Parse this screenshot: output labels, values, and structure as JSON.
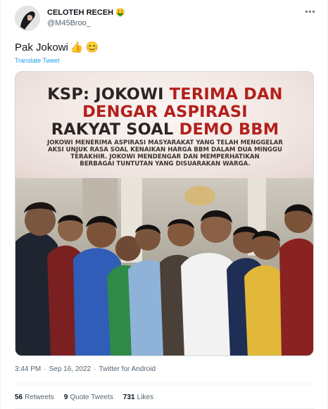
{
  "user": {
    "display_name": "CELOTEH RECEH",
    "name_emoji": "🤑",
    "handle": "@M45Broo_"
  },
  "tweet": {
    "text": "Pak Jokowi",
    "text_emojis": [
      "👍",
      "😊"
    ],
    "translate_label": "Translate Tweet"
  },
  "media": {
    "headline_line1_dark": "KSP: JOKOWI ",
    "headline_line1_red": "TERIMA DAN",
    "headline_line2_red": "DENGAR ASPIRASI",
    "headline_line3_dark": "RAKYAT SOAL ",
    "headline_line3_red": "DEMO BBM",
    "caption_lines": [
      "JOKOWI MENERIMA ASPIRASI MASYARAKAT YANG TELAH MENGGELAR",
      "AKSI UNJUK RASA SOAL KENAIKAN HARGA BBM DALAM DUA MINGGU",
      "TERAKHIR. JOKOWI MENDENGAR DAN MEMPERHATIKAN",
      "BERBAGAI TUNTUTAN YANG DISUARAKAN WARGA."
    ],
    "colors": {
      "headline_dark": "#2b2422",
      "headline_red": "#b3201c"
    }
  },
  "meta": {
    "time": "3:44 PM",
    "separator": "·",
    "date": "Sep 16, 2022",
    "source": "Twitter for Android"
  },
  "stats": {
    "retweets_count": "56",
    "retweets_label": "Retweets",
    "quotes_count": "9",
    "quotes_label": "Quote Tweets",
    "likes_count": "731",
    "likes_label": "Likes"
  },
  "icons": {
    "more": "more-horizontal-icon"
  }
}
